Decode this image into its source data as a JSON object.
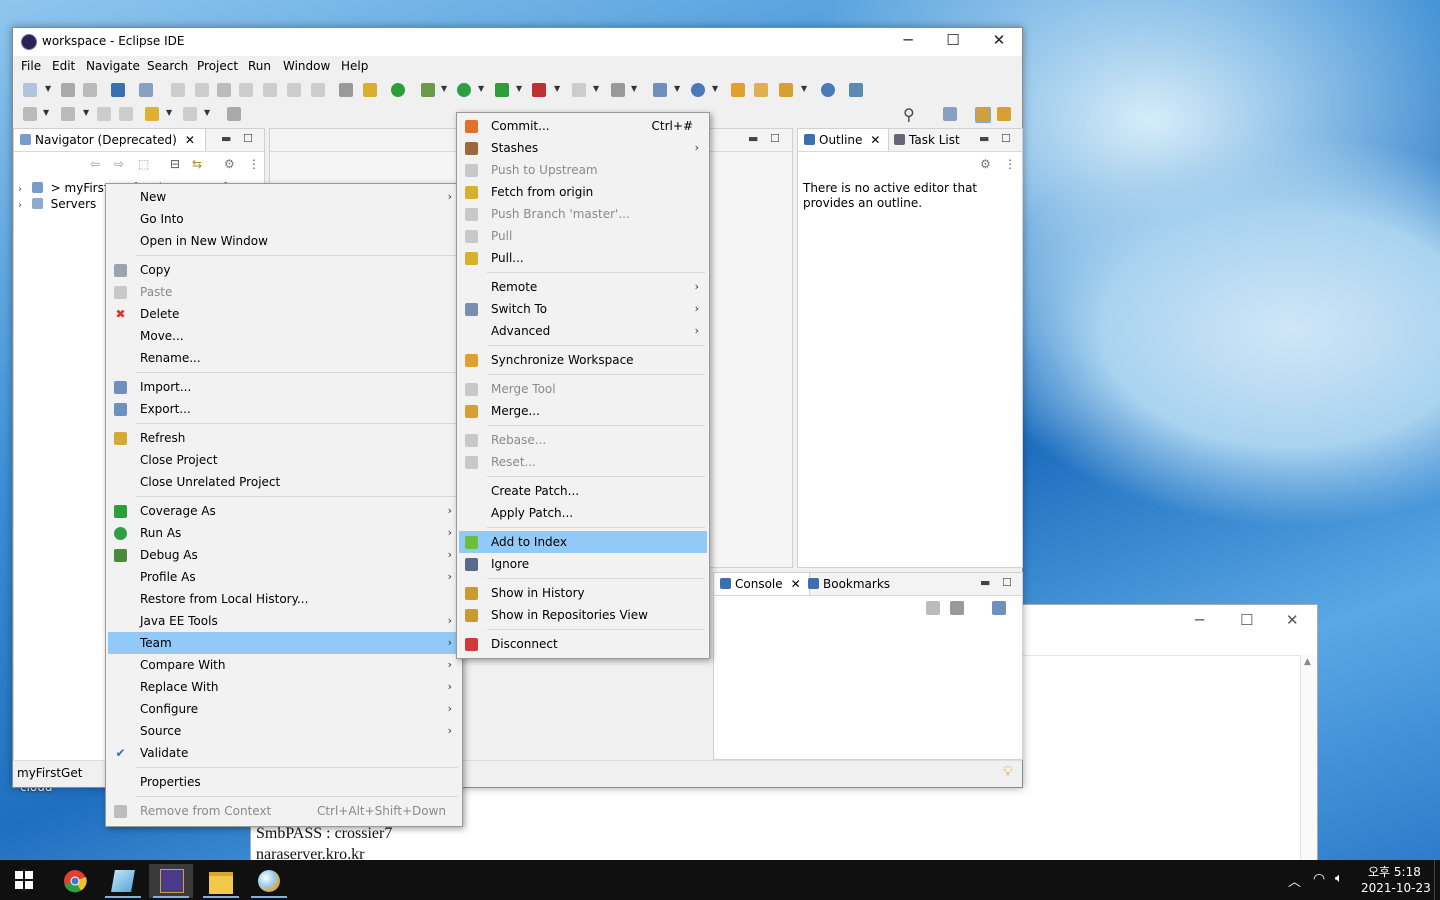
{
  "window": {
    "title": "workspace - Eclipse IDE",
    "minimize": "─",
    "maximize": "☐",
    "close": "✕"
  },
  "menubar": [
    "File",
    "Edit",
    "Navigate",
    "Search",
    "Project",
    "Run",
    "Window",
    "Help"
  ],
  "navigator": {
    "tab_label": "Navigator (Deprecated)",
    "items": [
      {
        "label": "> myFirstGet [Spring master]"
      },
      {
        "label": "Servers"
      }
    ],
    "status": "myFirstGet"
  },
  "outline": {
    "tab_label": "Outline",
    "task_list_label": "Task List",
    "message": "There is no active editor that provides an outline."
  },
  "console_panel": {
    "console_label": "Console",
    "bookmarks_label": "Bookmarks"
  },
  "context_menu": {
    "groups": [
      [
        {
          "label": "New",
          "submenu": true
        },
        {
          "label": "Go Into"
        },
        {
          "label": "Open in New Window"
        }
      ],
      [
        {
          "label": "Copy",
          "icon": "copy-icon"
        },
        {
          "label": "Paste",
          "icon": "paste-icon",
          "disabled": true
        },
        {
          "label": "Delete",
          "icon": "delete-icon"
        },
        {
          "label": "Move..."
        },
        {
          "label": "Rename..."
        }
      ],
      [
        {
          "label": "Import...",
          "icon": "import-icon"
        },
        {
          "label": "Export...",
          "icon": "export-icon"
        }
      ],
      [
        {
          "label": "Refresh",
          "icon": "refresh-icon"
        },
        {
          "label": "Close Project"
        },
        {
          "label": "Close Unrelated Project"
        }
      ],
      [
        {
          "label": "Coverage As",
          "icon": "coverage-icon",
          "submenu": true
        },
        {
          "label": "Run As",
          "icon": "run-icon",
          "submenu": true
        },
        {
          "label": "Debug As",
          "icon": "debug-icon",
          "submenu": true
        },
        {
          "label": "Profile As",
          "submenu": true
        },
        {
          "label": "Restore from Local History..."
        },
        {
          "label": "Java EE Tools",
          "submenu": true
        },
        {
          "label": "Team",
          "submenu": true,
          "selected": true
        },
        {
          "label": "Compare With",
          "submenu": true
        },
        {
          "label": "Replace With",
          "submenu": true
        },
        {
          "label": "Configure",
          "submenu": true
        },
        {
          "label": "Source",
          "submenu": true
        },
        {
          "label": "Validate",
          "icon": "checkbox-icon"
        }
      ],
      [
        {
          "label": "Properties"
        }
      ],
      [
        {
          "label": "Remove from Context",
          "accelerator": "Ctrl+Alt+Shift+Down",
          "icon": "remove-context-icon",
          "disabled": true
        }
      ]
    ]
  },
  "team_menu": {
    "groups": [
      [
        {
          "label": "Commit...",
          "accelerator": "Ctrl+#",
          "icon": "commit-icon"
        },
        {
          "label": "Stashes",
          "icon": "stashes-icon",
          "submenu": true
        },
        {
          "label": "Push to Upstream",
          "icon": "push-icon",
          "disabled": true
        },
        {
          "label": "Fetch from origin",
          "icon": "fetch-icon"
        },
        {
          "label": "Push Branch 'master'...",
          "icon": "push-branch-icon",
          "disabled": true
        },
        {
          "label": "Pull",
          "icon": "pull-icon",
          "disabled": true
        },
        {
          "label": "Pull...",
          "icon": "pull-dialog-icon"
        }
      ],
      [
        {
          "label": "Remote",
          "submenu": true
        },
        {
          "label": "Switch To",
          "icon": "switch-icon",
          "submenu": true
        },
        {
          "label": "Advanced",
          "submenu": true
        }
      ],
      [
        {
          "label": "Synchronize Workspace",
          "icon": "synchronize-icon"
        }
      ],
      [
        {
          "label": "Merge Tool",
          "icon": "merge-tool-icon",
          "disabled": true
        },
        {
          "label": "Merge...",
          "icon": "merge-icon"
        }
      ],
      [
        {
          "label": "Rebase...",
          "icon": "rebase-icon",
          "disabled": true
        },
        {
          "label": "Reset...",
          "icon": "reset-icon",
          "disabled": true
        }
      ],
      [
        {
          "label": "Create Patch..."
        },
        {
          "label": "Apply Patch..."
        }
      ],
      [
        {
          "label": "Add to Index",
          "icon": "add-index-icon",
          "selected": true
        },
        {
          "label": "Ignore",
          "icon": "ignore-icon"
        }
      ],
      [
        {
          "label": "Show in History",
          "icon": "history-icon"
        },
        {
          "label": "Show in Repositories View",
          "icon": "repositories-icon"
        }
      ],
      [
        {
          "label": "Disconnect",
          "icon": "disconnect-icon"
        }
      ]
    ]
  },
  "background_window": {
    "lines": [
      "SmbPASS : crossier7",
      "naraserver.kro.kr"
    ]
  },
  "desktop_labels": [
    "cloud"
  ],
  "taskbar": {
    "time": "오후 5:18",
    "date": "2021-10-23"
  },
  "icon_colors": {
    "copy-icon": "#9aa4b0",
    "paste-icon": "#c8c8c8",
    "delete-icon": "#e03030",
    "import-icon": "#6f8fbf",
    "export-icon": "#6f8fbf",
    "refresh-icon": "#d4a93a",
    "coverage-icon": "#2e9e3a",
    "run-icon": "#2ea043",
    "debug-icon": "#4a8a3a",
    "checkbox-icon": "#2b6fc0",
    "remove-context-icon": "#bdbdbd",
    "commit-icon": "#e0702a",
    "stashes-icon": "#9b6a3a",
    "push-icon": "#c8c8c8",
    "fetch-icon": "#d8b030",
    "push-branch-icon": "#c8c8c8",
    "pull-icon": "#c8c8c8",
    "pull-dialog-icon": "#d8b030",
    "switch-icon": "#7a8fb0",
    "synchronize-icon": "#e0a030",
    "merge-tool-icon": "#c8c8c8",
    "merge-icon": "#d8a030",
    "rebase-icon": "#c8c8c8",
    "reset-icon": "#c8c8c8",
    "add-index-icon": "#6bbf3a",
    "ignore-icon": "#5a6a8a",
    "history-icon": "#c89a30",
    "repositories-icon": "#c89a30",
    "disconnect-icon": "#d03a3a"
  }
}
